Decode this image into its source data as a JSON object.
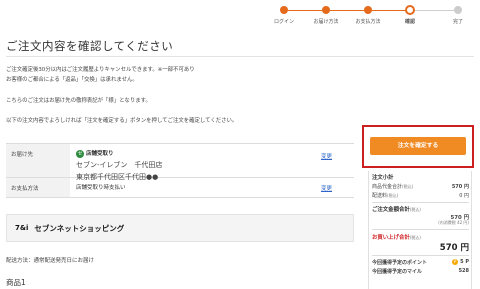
{
  "steps": [
    {
      "label": "ログイン",
      "state": "done"
    },
    {
      "label": "お届け方法",
      "state": "done"
    },
    {
      "label": "お支払方法",
      "state": "done"
    },
    {
      "label": "確認",
      "state": "current"
    },
    {
      "label": "完了",
      "state": "todo"
    }
  ],
  "page_title": "ご注文内容を確認してください",
  "notices": {
    "line1": "ご注文確定後30分以内はご注文履歴よりキャンセルできます。※一部不可あり",
    "line2": "お客様のご都合による「返品」「交換」は承れません。",
    "line3": "こちらのご注文はお届け先の敬称表記が「様」となります。",
    "line4": "以下の注文内容でよろしければ「注文を確定する」ボタンを押してご注文を確定してください。"
  },
  "delivery": {
    "header": "お届け先",
    "badge": "セ",
    "method": "店舗受取り",
    "store": "セブン-イレブン　千代田店",
    "address": "東京都千代田区千代田●●",
    "change": "変更"
  },
  "payment": {
    "header": "お支払方法",
    "value": "店舗受取り時支払い",
    "change": "変更"
  },
  "shop": {
    "logo": "7&i",
    "name": "セブンネットショッピング"
  },
  "delivery_method": "配送方法：通常配送発売日にお届け",
  "item_name": "商品1",
  "summary": {
    "confirm_button": "注文を確定する",
    "heading": "注文小計",
    "subtotal_label": "商品代金合計",
    "subtotal_tax": "(税込)",
    "subtotal_value": "570 円",
    "shipping_label": "配送料",
    "shipping_tax": "(税込)",
    "shipping_value": "0 円",
    "total_label": "ご注文金額合計",
    "total_tax": "(税込)",
    "total_value": "570 円",
    "total_note": "(内消費税 42 円)",
    "pay_label": "お買い上げ合計",
    "pay_tax": "(税込)",
    "pay_value": "570 円",
    "points_label": "今回獲得予定のポイント",
    "points_badge": "P",
    "points_value": "5 P",
    "miles_label": "今回獲得予定のマイル",
    "miles_value": "528"
  }
}
